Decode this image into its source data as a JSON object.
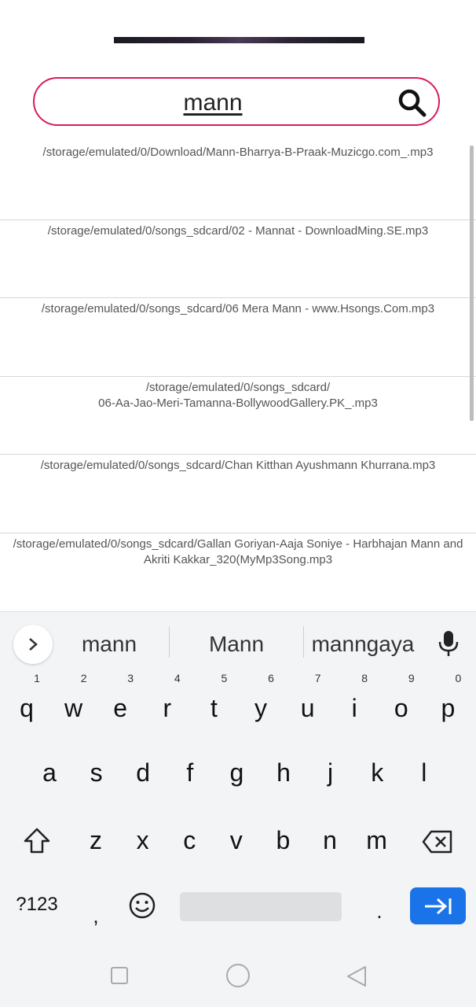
{
  "search": {
    "query": "mann"
  },
  "results": [
    {
      "path": "/storage/emulated/0/Download/Mann-Bharrya-B-Praak-Muzicgo.com_.mp3"
    },
    {
      "path": "/storage/emulated/0/songs_sdcard/02 - Mannat - DownloadMing.SE.mp3"
    },
    {
      "path": "/storage/emulated/0/songs_sdcard/06 Mera Mann - www.Hsongs.Com.mp3"
    },
    {
      "path": "/storage/emulated/0/songs_sdcard/\n06-Aa-Jao-Meri-Tamanna-BollywoodGallery.PK_.mp3"
    },
    {
      "path": "/storage/emulated/0/songs_sdcard/Chan Kitthan Ayushmann Khurrana.mp3"
    },
    {
      "path": "/storage/emulated/0/songs_sdcard/Gallan Goriyan-Aaja Soniye - Harbhajan Mann and Akriti Kakkar_320(MyMp3Song.mp3"
    }
  ],
  "keyboard": {
    "suggestions": [
      "mann",
      "Mann",
      "manngaya"
    ],
    "row1": [
      "q",
      "w",
      "e",
      "r",
      "t",
      "y",
      "u",
      "i",
      "o",
      "p"
    ],
    "row1_hints": [
      "1",
      "2",
      "3",
      "4",
      "5",
      "6",
      "7",
      "8",
      "9",
      "0"
    ],
    "row2": [
      "a",
      "s",
      "d",
      "f",
      "g",
      "h",
      "j",
      "k",
      "l"
    ],
    "row3": [
      "z",
      "x",
      "c",
      "v",
      "b",
      "n",
      "m"
    ],
    "symbols_label": "?123",
    "comma": ",",
    "period": "."
  },
  "colors": {
    "accent": "#d81b60",
    "enter": "#1a73e8"
  },
  "icons": {
    "search": "search-icon",
    "expand": "chevron-right-icon",
    "mic": "microphone-icon",
    "shift": "shift-icon",
    "backspace": "backspace-icon",
    "emoji": "emoji-icon",
    "enter": "next-arrow-icon",
    "recents": "square-icon",
    "home": "circle-icon",
    "back": "triangle-back-icon"
  }
}
